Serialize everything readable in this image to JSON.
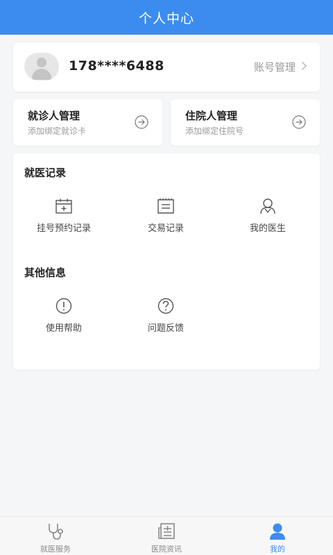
{
  "header": {
    "title": "个人中心"
  },
  "account": {
    "phone": "178****6488",
    "manage_label": "账号管理",
    "chevron": ">"
  },
  "managers": [
    {
      "title": "就诊人管理",
      "subtitle": "添加绑定就诊卡"
    },
    {
      "title": "住院人管理",
      "subtitle": "添加绑定住院号"
    }
  ],
  "medical_records": {
    "title": "就医记录",
    "items": [
      {
        "label": "挂号预约记录",
        "icon": "calendar-icon"
      },
      {
        "label": "交易记录",
        "icon": "document-icon"
      },
      {
        "label": "我的医生",
        "icon": "doctor-icon"
      }
    ]
  },
  "other_info": {
    "title": "其他信息",
    "items": [
      {
        "label": "使用帮助",
        "icon": "exclamation-circle-icon"
      },
      {
        "label": "问题反馈",
        "icon": "question-circle-icon"
      }
    ]
  },
  "tabbar": {
    "items": [
      {
        "label": "就医服务",
        "icon": "stethoscope-icon",
        "active": false
      },
      {
        "label": "医院资讯",
        "icon": "news-icon",
        "active": false
      },
      {
        "label": "我的",
        "icon": "user-icon",
        "active": true
      }
    ]
  },
  "colors": {
    "primary": "#3c8cf0",
    "background": "#f5f6f8"
  }
}
